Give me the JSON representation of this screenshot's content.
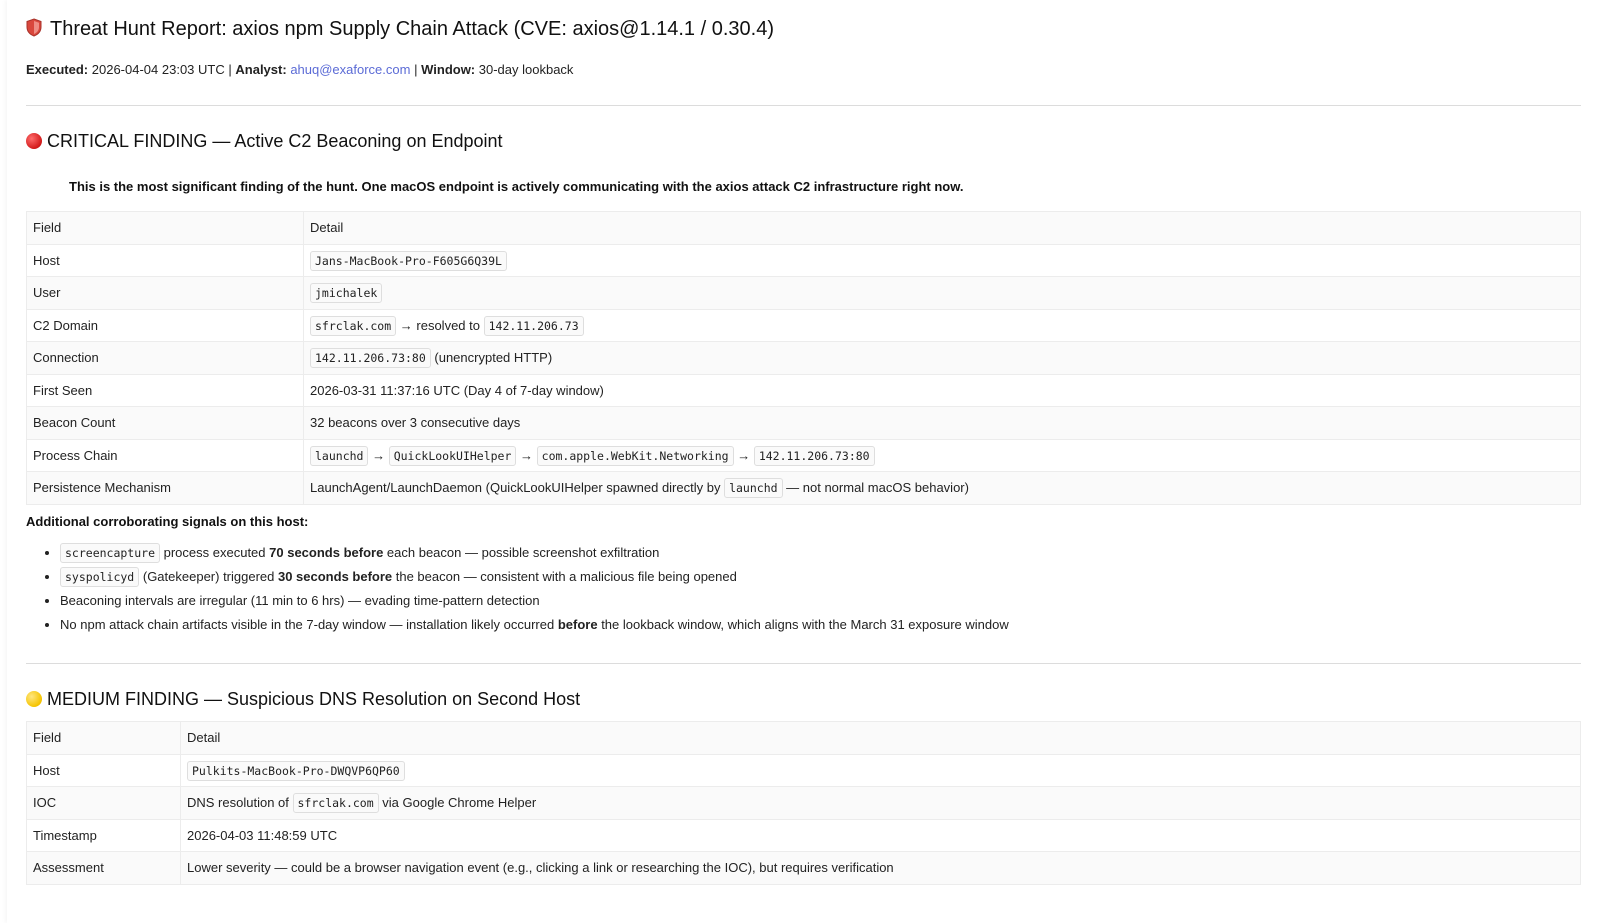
{
  "header": {
    "title": "Threat Hunt Report: axios npm Supply Chain Attack (CVE: axios@1.14.1 / 0.30.4)",
    "executed_label": "Executed:",
    "executed_value": "2026-04-04 23:03 UTC",
    "sep": "|",
    "analyst_label": "Analyst:",
    "analyst_email": "ahuq@exaforce.com",
    "window_label": "Window:",
    "window_value": "30-day lookback"
  },
  "critical": {
    "heading": "CRITICAL FINDING — Active C2 Beaconing on Endpoint",
    "summary": "This is the most significant finding of the hunt. One macOS endpoint is actively communicating with the axios attack C2 infrastructure right now.",
    "col_field": "Field",
    "col_detail": "Detail",
    "host_label": "Host",
    "host_value": "Jans-MacBook-Pro-F605G6Q39L",
    "user_label": "User",
    "user_value": "jmichalek",
    "c2_label": "C2 Domain",
    "c2_domain": "sfrclak.com",
    "c2_resolved": " → resolved to ",
    "c2_ip": "142.11.206.73",
    "conn_label": "Connection",
    "conn_value": "142.11.206.73:80",
    "conn_note": " (unencrypted HTTP)",
    "first_label": "First Seen",
    "first_value": "2026-03-31 11:37:16 UTC (Day 4 of 7-day window)",
    "beacon_label": "Beacon Count",
    "beacon_value": "32 beacons over 3 consecutive days",
    "chain_label": "Process Chain",
    "chain": [
      "launchd",
      "QuickLookUIHelper",
      "com.apple.WebKit.Networking",
      "142.11.206.73:80"
    ],
    "arrow": " → ",
    "persist_label": "Persistence Mechanism",
    "persist_pre": "LaunchAgent/LaunchDaemon (QuickLookUIHelper spawned directly by ",
    "persist_code": "launchd",
    "persist_post": " — not normal macOS behavior)"
  },
  "signals": {
    "title": "Additional corroborating signals on this host:",
    "s1_code": "screencapture",
    "s1_a": " process executed ",
    "s1_b": "70 seconds before",
    "s1_c": " each beacon — possible screenshot exfiltration",
    "s2_code": "syspolicyd",
    "s2_a": " (Gatekeeper) triggered ",
    "s2_b": "30 seconds before",
    "s2_c": " the beacon — consistent with a malicious file being opened",
    "s3": "Beaconing intervals are irregular (11 min to 6 hrs) — evading time-pattern detection",
    "s4_a": "No npm attack chain artifacts visible in the 7-day window — installation likely occurred ",
    "s4_b": "before",
    "s4_c": " the lookback window, which aligns with the March 31 exposure window"
  },
  "medium": {
    "heading": "MEDIUM FINDING — Suspicious DNS Resolution on Second Host",
    "col_field": "Field",
    "col_detail": "Detail",
    "host_label": "Host",
    "host_value": "Pulkits-MacBook-Pro-DWQVP6QP60",
    "ioc_label": "IOC",
    "ioc_pre": "DNS resolution of ",
    "ioc_code": "sfrclak.com",
    "ioc_post": " via Google Chrome Helper",
    "ts_label": "Timestamp",
    "ts_value": "2026-04-03 11:48:59 UTC",
    "assess_label": "Assessment",
    "assess_value": "Lower severity — could be a browser navigation event (e.g., clicking a link or researching the IOC), but requires verification"
  }
}
